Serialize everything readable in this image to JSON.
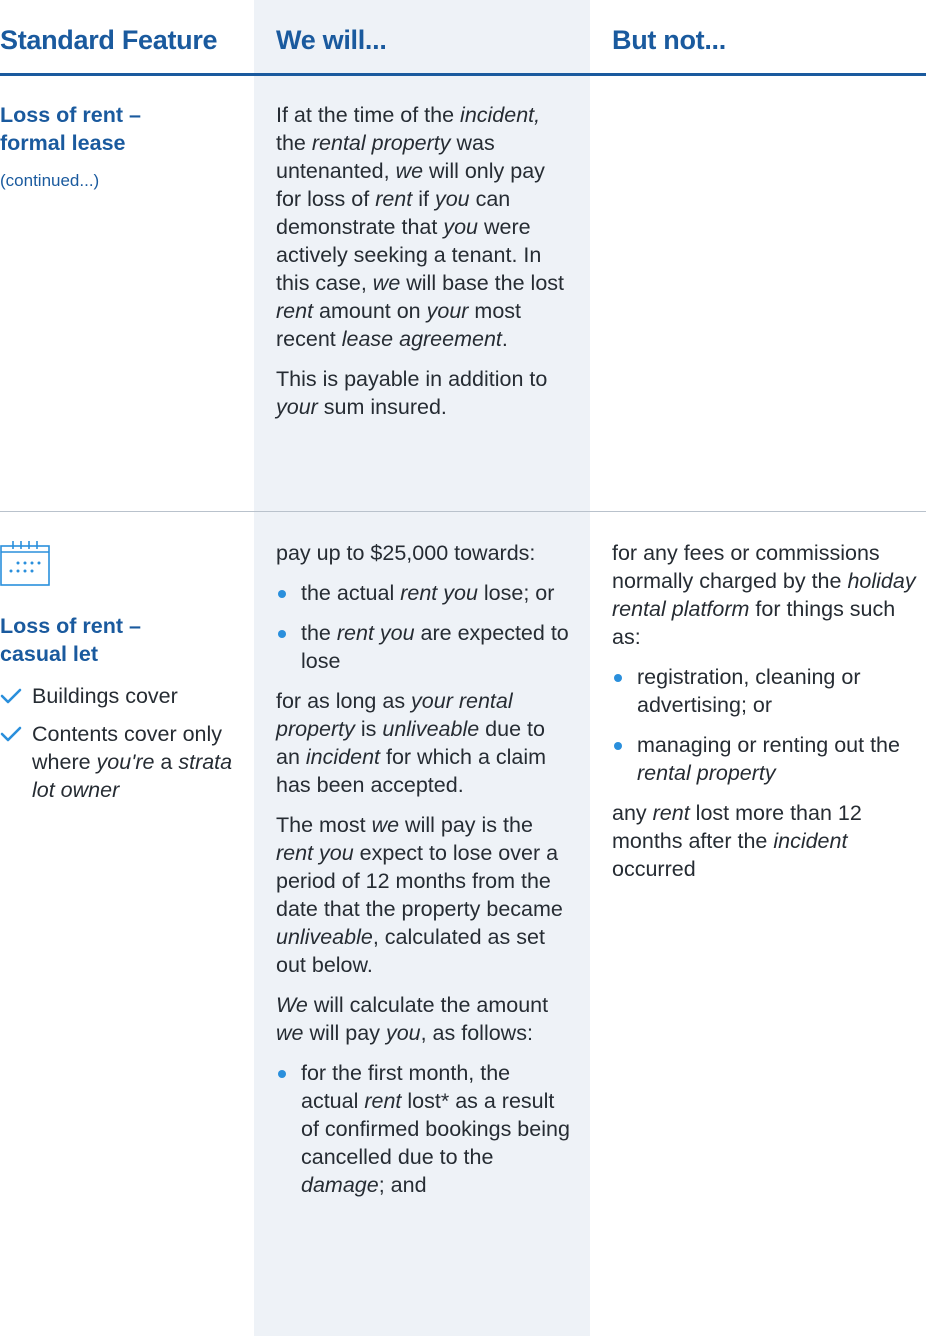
{
  "header": {
    "col1": "Standard Feature",
    "col2": "We will...",
    "col3": "But not..."
  },
  "row1": {
    "title_line1": "Loss of rent –",
    "title_line2": "formal lease",
    "continued": "(continued...)",
    "p1": {
      "t1": "If at the time of the ",
      "i1": "incident,",
      "t2": " the ",
      "i2": "rental property",
      "t3": " was untenanted, ",
      "i3": "we",
      "t4": " will only pay for loss of ",
      "i4": "rent",
      "t5": " if ",
      "i5": "you",
      "t6": " can demonstrate that ",
      "i6": "you",
      "t7": " were actively seeking a tenant. In this case, ",
      "i7": "we",
      "t8": " will base the lost ",
      "i8": "rent",
      "t9": " amount on ",
      "i9": "your",
      "t10": " most recent ",
      "i10": "lease agreement",
      "t11": "."
    },
    "p2": {
      "t1": "This is payable in addition to ",
      "i1": "your",
      "t2": " sum insured."
    }
  },
  "row2": {
    "icon": "calendar-icon",
    "title_line1": "Loss of rent –",
    "title_line2": "casual let",
    "check1": "Buildings cover",
    "check2": {
      "t1": "Contents cover only where ",
      "i1": "you're",
      "t2": " a ",
      "i2": "strata lot owner"
    },
    "will": {
      "intro": "pay up to $25,000 towards:",
      "b1": {
        "t1": "the actual ",
        "i1": "rent you",
        "t2": " lose; or"
      },
      "b2": {
        "t1": "the ",
        "i1": "rent you",
        "t2": " are expected to lose"
      },
      "p2": {
        "t1": "for as long as ",
        "i1": "your rental property",
        "t2": " is ",
        "i2": "unliveable",
        "t3": " due to an ",
        "i3": "incident",
        "t4": " for which a claim has been accepted."
      },
      "p3": {
        "t1": "The most ",
        "i1": "we",
        "t2": " will pay is the ",
        "i2": "rent you",
        "t3": " expect to lose over a period of 12 months from the date that the property became ",
        "i3": "unliveable",
        "t4": ", calculated as set out below."
      },
      "p4": {
        "i1": "We",
        "t1": " will calculate the amount ",
        "i2": "we",
        "t2": " will pay ",
        "i3": "you",
        "t3": ", as follows:"
      },
      "b3": {
        "t1": "for the first month, the actual ",
        "i1": "rent",
        "t2": " lost* as a result of confirmed bookings being cancelled due to the ",
        "i2": "damage",
        "t3": "; and"
      }
    },
    "not": {
      "p1": {
        "t1": "for any fees or commissions normally charged by the ",
        "i1": "holiday rental platform",
        "t2": " for things such as:"
      },
      "b1": "registration, cleaning or advertising; or",
      "b2": {
        "t1": "managing or renting out the ",
        "i1": "rental property"
      },
      "p2": {
        "t1": "any ",
        "i1": "rent",
        "t2": " lost more than 12 months after the ",
        "i2": "incident",
        "t3": " occurred"
      }
    }
  },
  "colors": {
    "heading_blue": "#1a5a9e",
    "bullet_blue": "#2a8fdc",
    "shaded_column": "#eef2f7"
  }
}
